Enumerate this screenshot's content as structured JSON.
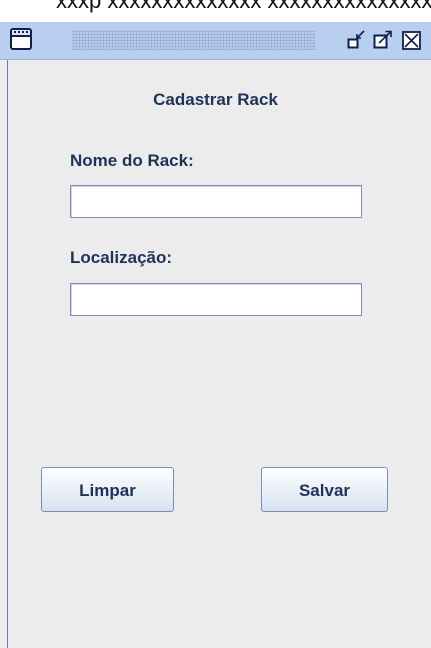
{
  "window": {
    "caption_fragment": "xxxp xxxxxxxxxxxxxx xxxxxxxxxxxxxxxxçxx",
    "buttons": {
      "iconify_icon": "iconify-icon",
      "maximize_icon": "maximize-icon",
      "close_icon": "close-icon"
    },
    "colors": {
      "titlebar": "#b8cff0",
      "frame": "#ececec",
      "label_text": "#1e3358",
      "border": "#7b8fb4"
    }
  },
  "form": {
    "title": "Cadastrar Rack",
    "fields": {
      "nome": {
        "label": "Nome do Rack:",
        "value": ""
      },
      "localizacao": {
        "label": "Localização:",
        "value": ""
      }
    },
    "buttons": {
      "limpar": "Limpar",
      "salvar": "Salvar"
    }
  }
}
